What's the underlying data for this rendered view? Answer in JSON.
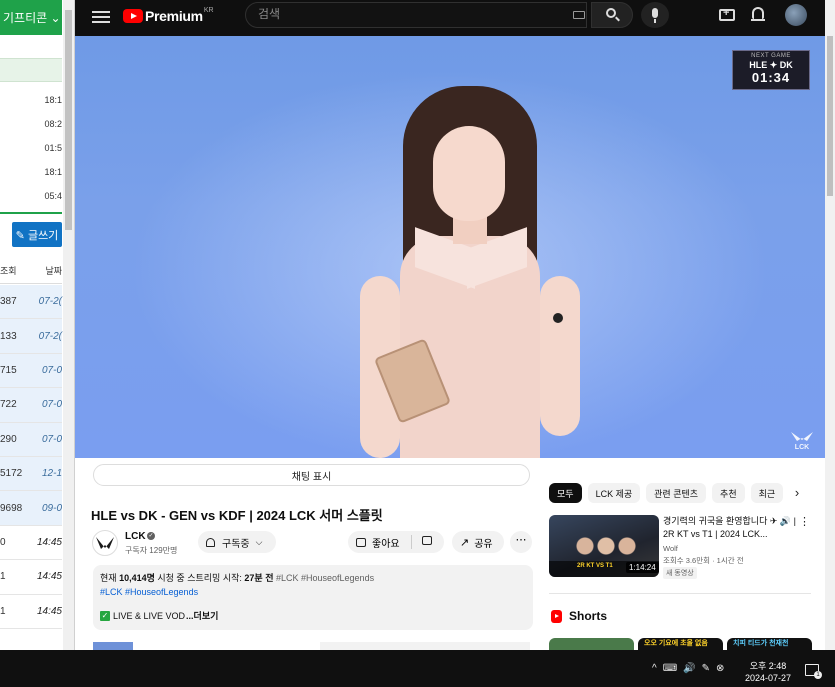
{
  "left_window": {
    "button_label": "기프티콘",
    "times": [
      "18:1",
      "08:2",
      "01:5",
      "18:1",
      "05:4"
    ],
    "write_button": "✎ 글쓰기",
    "columns": [
      "조회",
      "날짜"
    ],
    "rows": [
      {
        "views": "387",
        "date": "07-2("
      },
      {
        "views": "133",
        "date": "07-2("
      },
      {
        "views": "715",
        "date": "07-0"
      },
      {
        "views": "722",
        "date": "07-0"
      },
      {
        "views": "290",
        "date": "07-0"
      },
      {
        "views": "5172",
        "date": "12-1"
      },
      {
        "views": "9698",
        "date": "09-0"
      },
      {
        "views": "0",
        "date": "14:45"
      },
      {
        "views": "1",
        "date": "14:45"
      },
      {
        "views": "1",
        "date": "14:45"
      }
    ]
  },
  "youtube": {
    "logo_word": "Premium",
    "logo_region": "KR",
    "search_placeholder": "검색",
    "player": {
      "next_game_label": "NEXT GAME",
      "next_game_teams": "HLE ✦ DK",
      "next_game_time": "01:34",
      "watermark": "LCK"
    },
    "chat_toggle_label": "채팅 표시",
    "video_title": "HLE vs DK - GEN vs KDF | 2024 LCK 서머 스플릿",
    "channel": {
      "name": "LCK",
      "verified_mark": "✓",
      "subscribers": "구독자 129만명"
    },
    "subscribe_label": "구독중",
    "like_label": "좋아요",
    "share_label": "공유",
    "more_label": "⋯",
    "description": {
      "line1_prefix": "현재 ",
      "line1_viewers": "10,414명",
      "line1_mid": " 시청 중 스트리밍 시작: ",
      "line1_time": "27분 전",
      "line1_tags": "#LCK #HouseofLegends",
      "line2": "#LCK #HouseofLegends",
      "line3_check": "✓",
      "line3_text": "LIVE & LIVE VOD",
      "line3_more": "...더보기"
    },
    "chips": [
      "모두",
      "LCK 제공",
      "관련 콘텐츠",
      "추천",
      "최근"
    ],
    "recommended": {
      "title": "경기력의 귀국을 환영합니다 ✈ 🔊 | 2R KT vs T1 | 2024 LCK...",
      "channel": "Wolf",
      "meta": "조회수 3.6만회 · 1시간 전",
      "badge": "새 동영상",
      "duration": "1:14:24",
      "thumb_tag": "2R KT VS T1"
    },
    "shorts_label": "Shorts",
    "short_captions": [
      "",
      "오오 기요에 초올 없음",
      "치피 티드가 천재천"
    ]
  },
  "taskbar": {
    "tray": [
      "^",
      "⌨",
      "🔊",
      "✎",
      "⊗"
    ],
    "time": "오후 2:48",
    "date": "2024-07-27",
    "notif_count": "1"
  }
}
